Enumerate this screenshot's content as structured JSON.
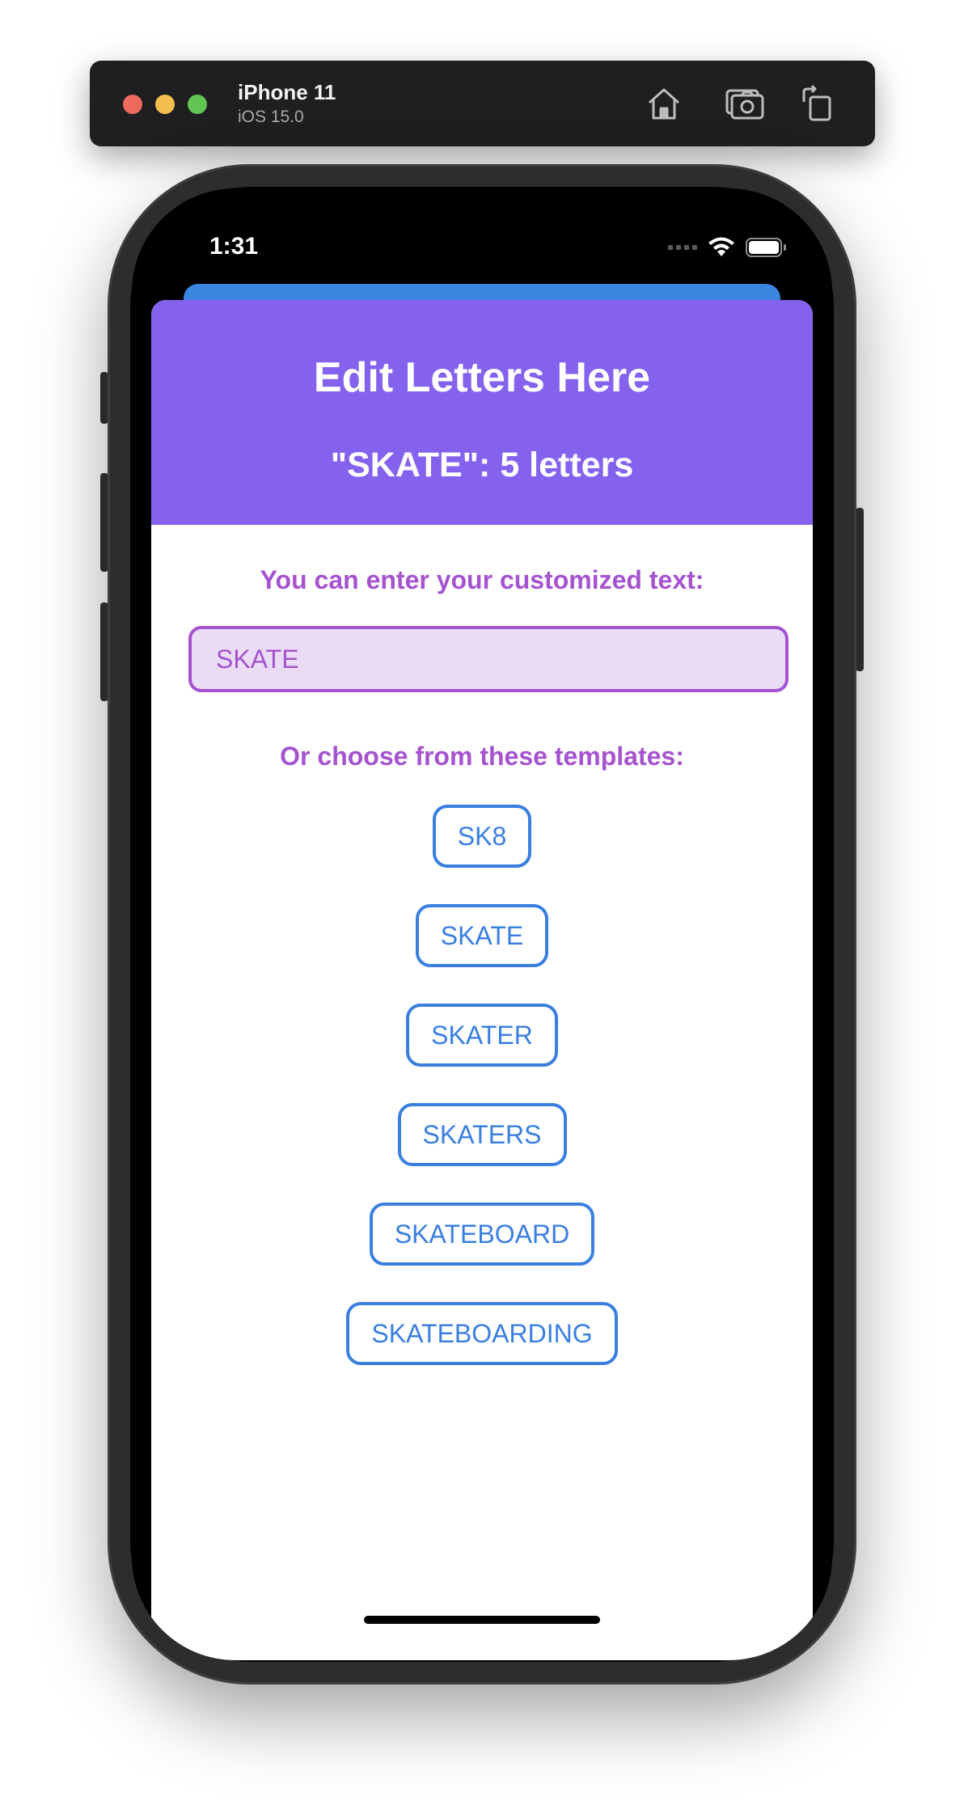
{
  "simulator": {
    "device_name": "iPhone 11",
    "os_version": "iOS 15.0",
    "icons": [
      "home-icon",
      "screenshot-icon",
      "rotate-icon"
    ]
  },
  "status_bar": {
    "time": "1:31",
    "icons": [
      "cellular-signal-icon",
      "wifi-icon",
      "battery-icon"
    ]
  },
  "sheet": {
    "title": "Edit Letters Here",
    "subtitle": "\"SKATE\": 5 letters",
    "custom_prompt": "You can enter your customized text:",
    "input_value": "SKATE",
    "templates_prompt": "Or choose from these templates:",
    "templates": [
      "SK8",
      "SKATE",
      "SKATER",
      "SKATERS",
      "SKATEBOARD",
      "SKATEBOARDING"
    ]
  },
  "colors": {
    "header": "#8562ee",
    "accent_purple": "#a553cf",
    "input_fill": "#eadcf5",
    "accent_blue": "#3a7fe0",
    "back_card": "#3a86e0"
  }
}
